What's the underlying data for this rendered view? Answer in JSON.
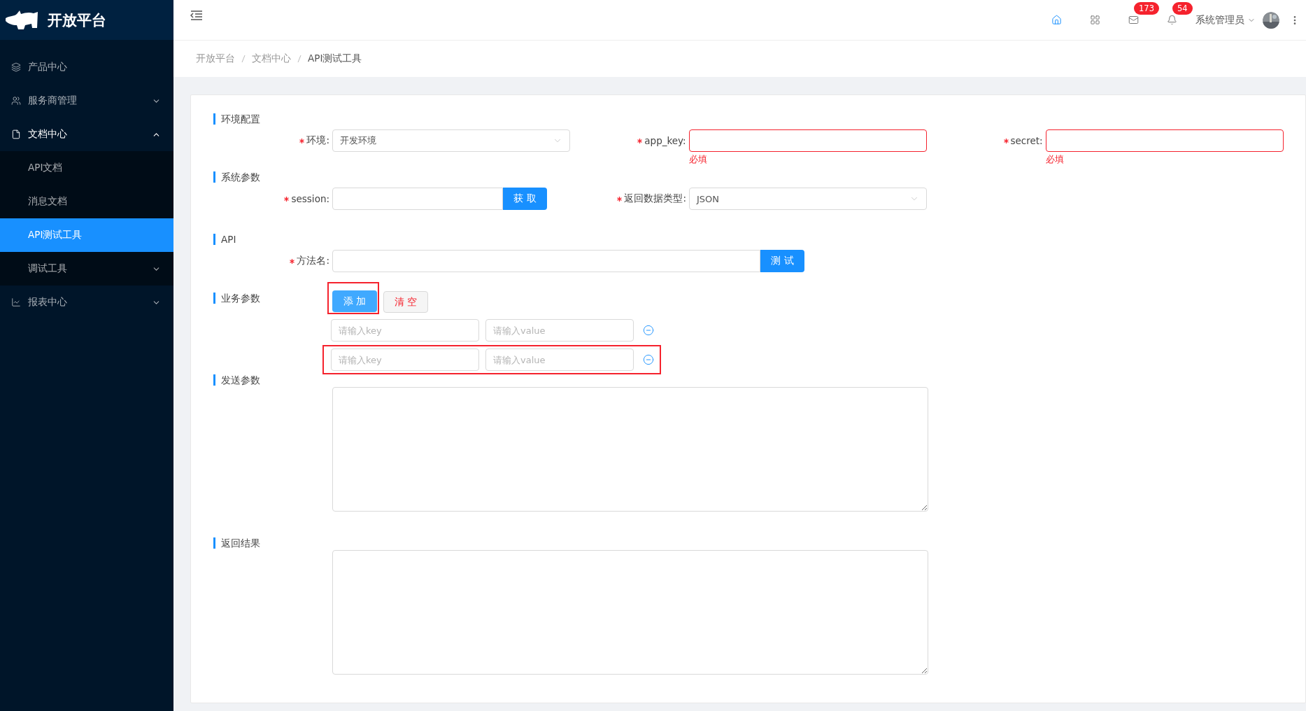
{
  "sidebar": {
    "brand": "开放平台",
    "menu": [
      {
        "label": "产品中心"
      },
      {
        "label": "服务商管理",
        "expanded": false
      },
      {
        "label": "文档中心",
        "expanded": true,
        "children": [
          {
            "label": "API文档",
            "selected": false
          },
          {
            "label": "消息文档",
            "selected": false
          },
          {
            "label": "API测试工具",
            "selected": true
          },
          {
            "label": "调试工具",
            "selected": false,
            "expanded": false
          }
        ]
      },
      {
        "label": "报表中心",
        "expanded": false
      }
    ]
  },
  "header": {
    "icons": [
      {
        "kind": "home",
        "selected": true
      },
      {
        "kind": "apps",
        "selected": false
      },
      {
        "kind": "mail",
        "selected": false,
        "badge": "173"
      },
      {
        "kind": "bell",
        "selected": false,
        "badge": "54"
      }
    ],
    "user": "系统管理员"
  },
  "breadcrumb": [
    "开放平台",
    "文档中心",
    "API测试工具"
  ],
  "sections": [
    {
      "kind": "fields",
      "title": "环境配置",
      "fields": [
        {
          "kind": "select",
          "label": "环境:",
          "required": true,
          "value": "开发环境"
        },
        {
          "kind": "input",
          "label": "app_key:",
          "required": true,
          "error": "必填"
        },
        {
          "kind": "input",
          "label": "secret:",
          "required": true,
          "error": "必填"
        }
      ]
    },
    {
      "kind": "fields",
      "title": "系统参数",
      "fields": [
        {
          "kind": "input-button",
          "label": "session:",
          "required": true,
          "button": "获 取"
        },
        {
          "kind": "select",
          "label": "返回数据类型:",
          "required": true,
          "value": "JSON"
        }
      ]
    },
    {
      "kind": "fields",
      "title": "API",
      "fields": [
        {
          "kind": "input-button",
          "label": "方法名:",
          "required": true,
          "button": "测 试"
        }
      ]
    },
    {
      "kind": "params",
      "title": "业务参数",
      "add": {
        "label": "添 加",
        "highlighted": true
      },
      "clear": "清 空",
      "rows": [
        {
          "key_placeholder": "请输入key",
          "value_placeholder": "请输入value",
          "highlighted": false
        },
        {
          "key_placeholder": "请输入key",
          "value_placeholder": "请输入value",
          "highlighted": true
        }
      ]
    },
    {
      "kind": "textarea",
      "title": "发送参数"
    },
    {
      "kind": "textarea",
      "title": "返回结果"
    }
  ]
}
